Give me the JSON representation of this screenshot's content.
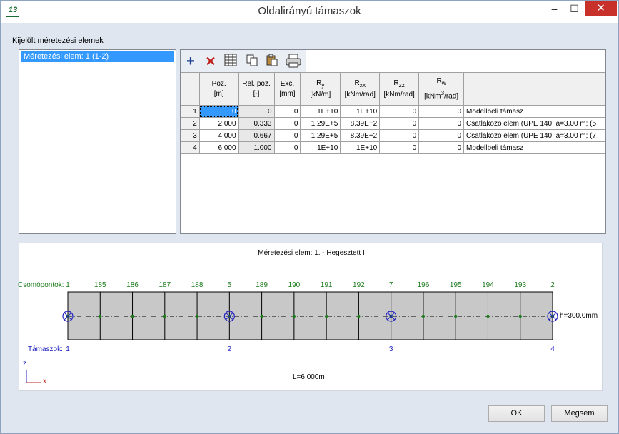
{
  "window": {
    "title": "Oldalirányú támaszok",
    "app_icon": "13"
  },
  "colors": {
    "selection": "#3399ff",
    "node_green": "#1a7a1a",
    "support_blue": "#2020c0",
    "close_red": "#c7312a"
  },
  "left_panel": {
    "group_label": "Kijelölt méretezési elemek",
    "items": [
      "Méretezési elem: 1 (1-2)"
    ]
  },
  "toolbar": {
    "icons": [
      "add-icon",
      "delete-icon",
      "columns-icon",
      "copy-icon",
      "paste-icon",
      "print-icon"
    ]
  },
  "table": {
    "headers": [
      {
        "line1": "Poz.",
        "line2": "[m]"
      },
      {
        "line1": "Rel. poz.",
        "line2": "[-]"
      },
      {
        "line1": "Exc.",
        "line2": "[mm]"
      },
      {
        "line1": "R",
        "sub": "y",
        "line2": "[kN/m]"
      },
      {
        "line1": "R",
        "sub": "xx",
        "line2": "[kNm/rad]"
      },
      {
        "line1": "R",
        "sub": "zz",
        "line2": "[kNm/rad]"
      },
      {
        "line1": "R",
        "sub": "w",
        "line2": "[kNm",
        "sup": "3",
        "line2b": "/rad]"
      }
    ],
    "rows": [
      {
        "n": "1",
        "poz": "0",
        "rel": "0",
        "exc": "0",
        "ry": "1E+10",
        "rxx": "1E+10",
        "rzz": "0",
        "rw": "0",
        "desc": "Modellbeli támasz"
      },
      {
        "n": "2",
        "poz": "2.000",
        "rel": "0.333",
        "exc": "0",
        "ry": "1.29E+5",
        "rxx": "8.39E+2",
        "rzz": "0",
        "rw": "0",
        "desc": "Csatlakozó elem (UPE 140: a=3.00 m; (5"
      },
      {
        "n": "3",
        "poz": "4.000",
        "rel": "0.667",
        "exc": "0",
        "ry": "1.29E+5",
        "rxx": "8.39E+2",
        "rzz": "0",
        "rw": "0",
        "desc": "Csatlakozó elem (UPE 140: a=3.00 m; (7"
      },
      {
        "n": "4",
        "poz": "6.000",
        "rel": "1.000",
        "exc": "0",
        "ry": "1E+10",
        "rxx": "1E+10",
        "rzz": "0",
        "rw": "0",
        "desc": "Modellbeli támasz"
      }
    ]
  },
  "diagram": {
    "title": "Méretezési elem: 1. - Hegesztett I",
    "nodes_label": "Csomópontok:",
    "nodes": [
      "1",
      "185",
      "186",
      "187",
      "188",
      "5",
      "189",
      "190",
      "191",
      "192",
      "7",
      "196",
      "195",
      "194",
      "193",
      "2"
    ],
    "supports_label": "Támaszok:",
    "supports": [
      "1",
      "2",
      "3",
      "4"
    ],
    "height_label": "h=300.0mm",
    "length_label": "L=6.000m",
    "axis_z": "z",
    "axis_x": "x"
  },
  "buttons": {
    "ok": "OK",
    "cancel": "Mégsem"
  }
}
